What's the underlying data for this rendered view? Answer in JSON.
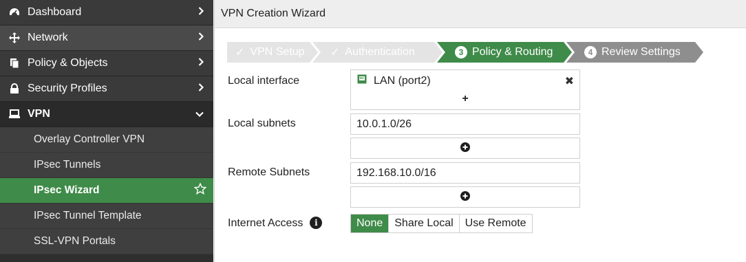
{
  "sidebar": {
    "items": [
      {
        "label": "Dashboard",
        "icon": "dashboard-icon"
      },
      {
        "label": "Network",
        "icon": "network-icon"
      },
      {
        "label": "Policy & Objects",
        "icon": "policy-icon"
      },
      {
        "label": "Security Profiles",
        "icon": "lock-icon"
      },
      {
        "label": "VPN",
        "icon": "laptop-icon"
      }
    ],
    "vpn_sub": [
      {
        "label": "Overlay Controller VPN"
      },
      {
        "label": "IPsec Tunnels"
      },
      {
        "label": "IPsec Wizard"
      },
      {
        "label": "IPsec Tunnel Template"
      },
      {
        "label": "SSL-VPN Portals"
      }
    ]
  },
  "page": {
    "title": "VPN Creation Wizard"
  },
  "steps": [
    {
      "label": "VPN Setup",
      "state": "done"
    },
    {
      "label": "Authentication",
      "state": "done"
    },
    {
      "number": "3",
      "label": "Policy & Routing",
      "state": "current"
    },
    {
      "number": "4",
      "label": "Review Settings",
      "state": "todo"
    }
  ],
  "form": {
    "local_interface_label": "Local interface",
    "local_interface_value": "LAN (port2)",
    "local_subnets_label": "Local subnets",
    "local_subnets_value": "10.0.1.0/26",
    "remote_subnets_label": "Remote Subnets",
    "remote_subnets_value": "192.168.10.0/16",
    "internet_access_label": "Internet Access",
    "internet_access_options": [
      "None",
      "Share Local",
      "Use Remote"
    ],
    "internet_access_selected": "None"
  },
  "colors": {
    "accent_green": "#3f8b49",
    "sidebar_bg": "#2e2e2e"
  }
}
